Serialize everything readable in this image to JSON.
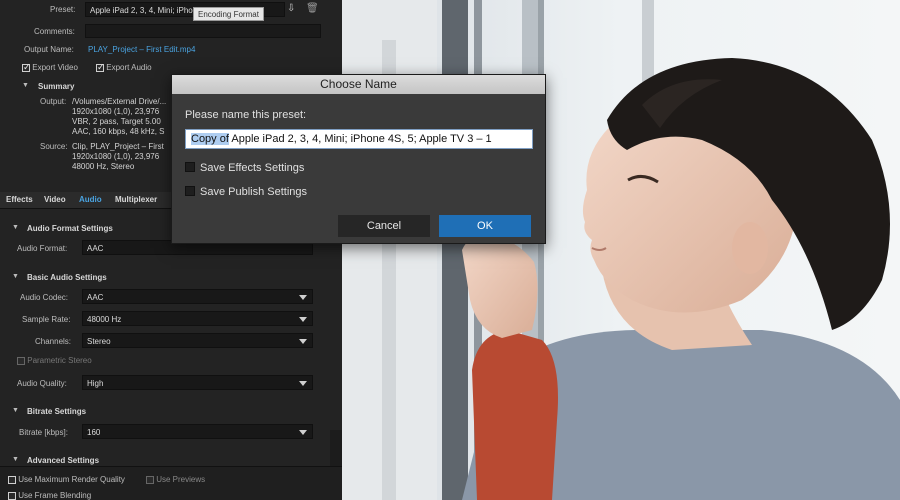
{
  "tooltip": "Encoding Format",
  "top": {
    "preset_label": "Preset:",
    "preset_value": "Apple iPad 2, 3, 4, Mini; iPho",
    "comments_label": "Comments:",
    "output_name_label": "Output Name:",
    "output_name_value": "PLAY_Project – First Edit.mp4",
    "export_video": "Export Video",
    "export_audio": "Export Audio"
  },
  "summary": {
    "title": "Summary",
    "output_label": "Output:",
    "output_lines": [
      "/Volumes/External Drive/...",
      "1920x1080 (1,0), 23,976",
      "VBR, 2 pass, Target 5.00",
      "AAC, 160 kbps, 48 kHz, S"
    ],
    "source_label": "Source:",
    "source_lines": [
      "Clip, PLAY_Project – First",
      "1920x1080 (1,0), 23,976",
      "48000 Hz, Stereo"
    ]
  },
  "tabs": [
    "Effects",
    "Video",
    "Audio",
    "Multiplexer"
  ],
  "audio_format_settings": {
    "title": "Audio Format Settings",
    "label": "Audio Format:",
    "value": "AAC"
  },
  "basic_audio_settings": {
    "title": "Basic Audio Settings",
    "codec_label": "Audio Codec:",
    "codec_value": "AAC",
    "rate_label": "Sample Rate:",
    "rate_value": "48000 Hz",
    "channels_label": "Channels:",
    "channels_value": "Stereo",
    "parametric_stereo": "Parametric Stereo",
    "quality_label": "Audio Quality:",
    "quality_value": "High"
  },
  "bitrate_settings": {
    "title": "Bitrate Settings",
    "label": "Bitrate [kbps]:",
    "value": "160"
  },
  "advanced_settings": {
    "title": "Advanced Settings"
  },
  "bottom": {
    "max_render": "Use Maximum Render Quality",
    "use_previews": "Use Previews",
    "frame_blending": "Use Frame Blending"
  },
  "dialog": {
    "title": "Choose Name",
    "prompt": "Please name this preset:",
    "name_selected": "Copy of",
    "name_rest": " Apple iPad 2, 3, 4, Mini; iPhone 4S, 5; Apple TV 3 – 1",
    "save_effects": "Save Effects Settings",
    "save_publish": "Save Publish Settings",
    "cancel": "Cancel",
    "ok": "OK"
  },
  "colors": {
    "accent": "#1f6fb6",
    "link_blue": "#4aa3e0",
    "panel_bg": "#232323"
  }
}
